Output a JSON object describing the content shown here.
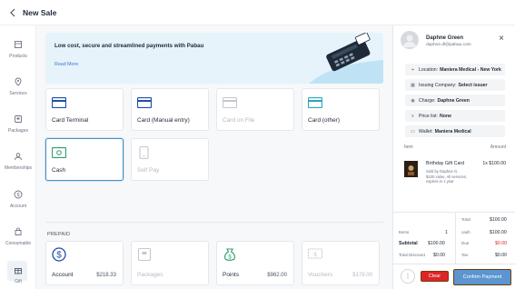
{
  "header": {
    "title": "New Sale",
    "back_icon": "arrow-left-icon"
  },
  "sidebar": {
    "items": [
      {
        "label": "Products",
        "icon": "box-icon"
      },
      {
        "label": "Services",
        "icon": "location-pin-icon"
      },
      {
        "label": "Packages",
        "icon": "package-icon"
      },
      {
        "label": "Memberships",
        "icon": "users-icon"
      },
      {
        "label": "Account",
        "icon": "dollar-circle-icon"
      },
      {
        "label": "Consumable",
        "icon": "bag-icon"
      },
      {
        "label": "Gift",
        "icon": "gift-icon"
      }
    ],
    "active": "Gift"
  },
  "banner": {
    "text": "Low cost, secure and streamlined payments with Pabau",
    "link": "Read More"
  },
  "payment_methods": [
    {
      "label": "Card Terminal",
      "icon": "card-icon",
      "state": "enabled"
    },
    {
      "label": "Card (Manual entry)",
      "icon": "card-icon",
      "state": "enabled"
    },
    {
      "label": "Card on File",
      "icon": "card-icon",
      "state": "disabled"
    },
    {
      "label": "Card (other)",
      "icon": "card-icon",
      "state": "enabled"
    },
    {
      "label": "Cash",
      "icon": "cash-icon",
      "state": "selected"
    },
    {
      "label": "Self Pay",
      "icon": "phone-icon",
      "state": "disabled"
    }
  ],
  "prepaid": {
    "heading": "PREPAID",
    "items": [
      {
        "label": "Account",
        "value": "$218.33",
        "icon": "dollar-circle-icon",
        "state": "enabled"
      },
      {
        "label": "Packages",
        "value": "",
        "icon": "package-icon",
        "state": "disabled"
      },
      {
        "label": "Points",
        "value": "$962.00",
        "icon": "money-bag-icon",
        "state": "enabled"
      },
      {
        "label": "Vouchers",
        "value": "$179.00",
        "icon": "voucher-icon",
        "state": "disabled"
      }
    ]
  },
  "customer": {
    "name": "Daphne Green",
    "email": "daphne.dl@pabau.com",
    "close_icon": "close-icon"
  },
  "details": [
    {
      "key": "Location:",
      "value": "Maniera Medical - New York",
      "icon": "location-pin-icon"
    },
    {
      "key": "Issuing Company:",
      "value": "Select issuer",
      "icon": "building-icon"
    },
    {
      "key": "Charge:",
      "value": "Daphne Green",
      "icon": "user-icon"
    },
    {
      "key": "Price list:",
      "value": "None",
      "icon": "list-icon"
    },
    {
      "key": "Wallet:",
      "value": "Maniera Medical",
      "icon": "wallet-icon"
    }
  ],
  "table": {
    "col_item": "Item",
    "col_amount": "Amount",
    "items": [
      {
        "name": "Birthday Gift Card",
        "sub1": "Sold by Daphne G.",
        "sub2": "$100 value, All services,",
        "sub3": "expires in 1 year",
        "price": "1x $100.00"
      }
    ]
  },
  "totals": {
    "items_label": "Items",
    "items_value": "1",
    "subtotal_label": "Subtotal",
    "subtotal_value": "$100.00",
    "discount_label": "Total Discount",
    "discount_value": "$0.00",
    "total_label": "Total",
    "total_value": "$100.00",
    "cash_label": "cash",
    "cash_value": "$100.00",
    "due_label": "Due",
    "due_value": "$0.00",
    "tax_label": "Tax",
    "tax_value": "$0.00"
  },
  "footer": {
    "more": "⋮",
    "clear": "Clear",
    "confirm": "Confirm Payment"
  },
  "colors": {
    "accent": "#3b7bd3",
    "clear": "#dc2626",
    "confirm": "#5c95cf",
    "banner_bg": "#e6f3fb"
  }
}
